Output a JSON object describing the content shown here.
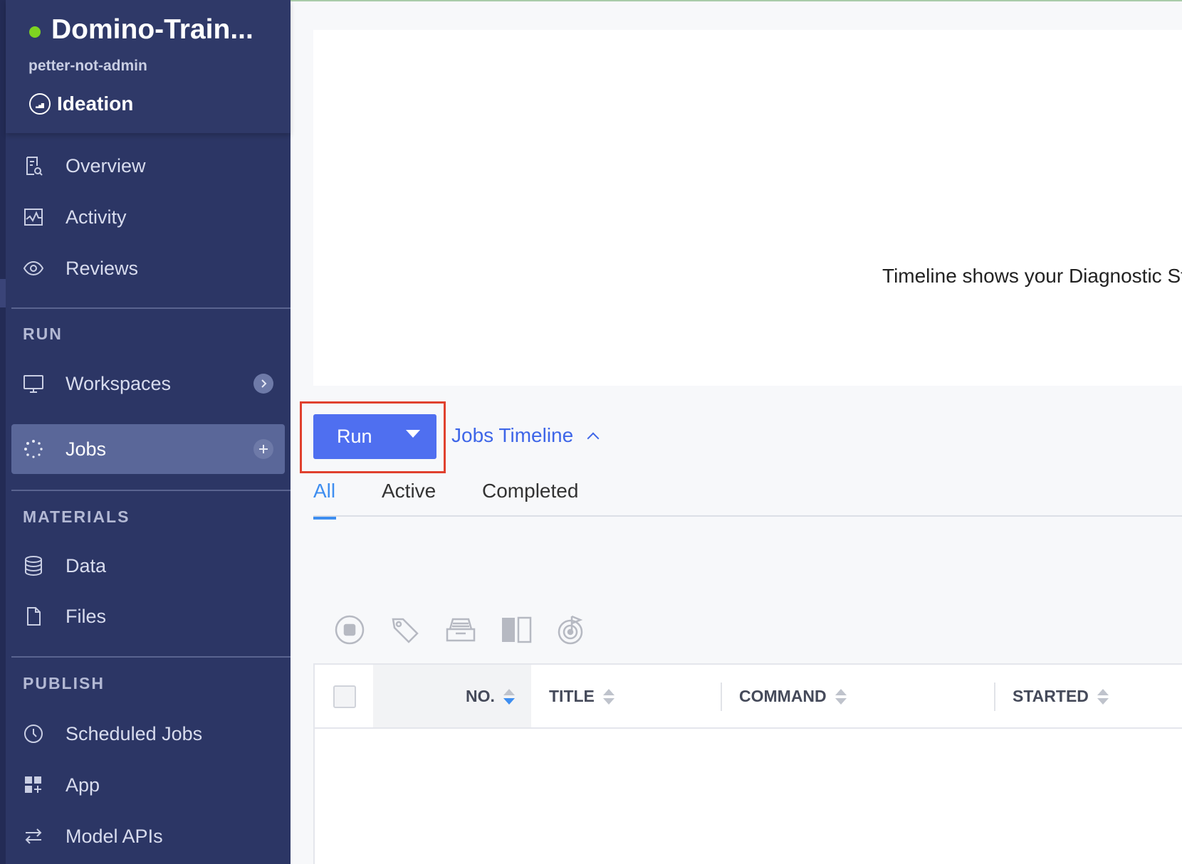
{
  "project": {
    "title": "Domino-Train...",
    "owner": "petter-not-admin",
    "stage": "Ideation",
    "status_color": "#7ed321"
  },
  "sidebar": {
    "nav": [
      {
        "label": "Overview",
        "icon": "overview-icon"
      },
      {
        "label": "Activity",
        "icon": "activity-icon"
      },
      {
        "label": "Reviews",
        "icon": "eye-icon"
      }
    ],
    "sections": [
      {
        "title": "RUN",
        "items": [
          {
            "label": "Workspaces",
            "icon": "monitor-icon",
            "extra": "chevron-right-icon"
          },
          {
            "label": "Jobs",
            "icon": "jobs-spinner-icon",
            "extra": "plus-icon",
            "active": true
          }
        ]
      },
      {
        "title": "MATERIALS",
        "items": [
          {
            "label": "Data",
            "icon": "database-icon"
          },
          {
            "label": "Files",
            "icon": "file-icon"
          }
        ]
      },
      {
        "title": "PUBLISH",
        "items": [
          {
            "label": "Scheduled Jobs",
            "icon": "clock-icon"
          },
          {
            "label": "App",
            "icon": "app-grid-icon"
          },
          {
            "label": "Model APIs",
            "icon": "arrows-swap-icon"
          }
        ]
      }
    ]
  },
  "timeline": {
    "message": "Timeline shows your Diagnostic St"
  },
  "actions": {
    "run_label": "Run",
    "jobs_timeline_label": "Jobs Timeline"
  },
  "tabs": [
    {
      "label": "All",
      "active": true
    },
    {
      "label": "Active",
      "active": false
    },
    {
      "label": "Completed",
      "active": false
    }
  ],
  "toolbar": {
    "icons": [
      "stop-icon",
      "tag-icon",
      "archive-icon",
      "compare-columns-icon",
      "goal-target-icon"
    ]
  },
  "table": {
    "columns": [
      {
        "label": "NO.",
        "sorted": "desc"
      },
      {
        "label": "TITLE"
      },
      {
        "label": "COMMAND"
      },
      {
        "label": "STARTED"
      }
    ]
  },
  "colors": {
    "sidebar_bg": "#2c3665",
    "accent_blue": "#4f6ff0",
    "link_blue": "#3e66e8",
    "tab_active": "#3e8ef0",
    "highlight_red": "#e0412e"
  }
}
